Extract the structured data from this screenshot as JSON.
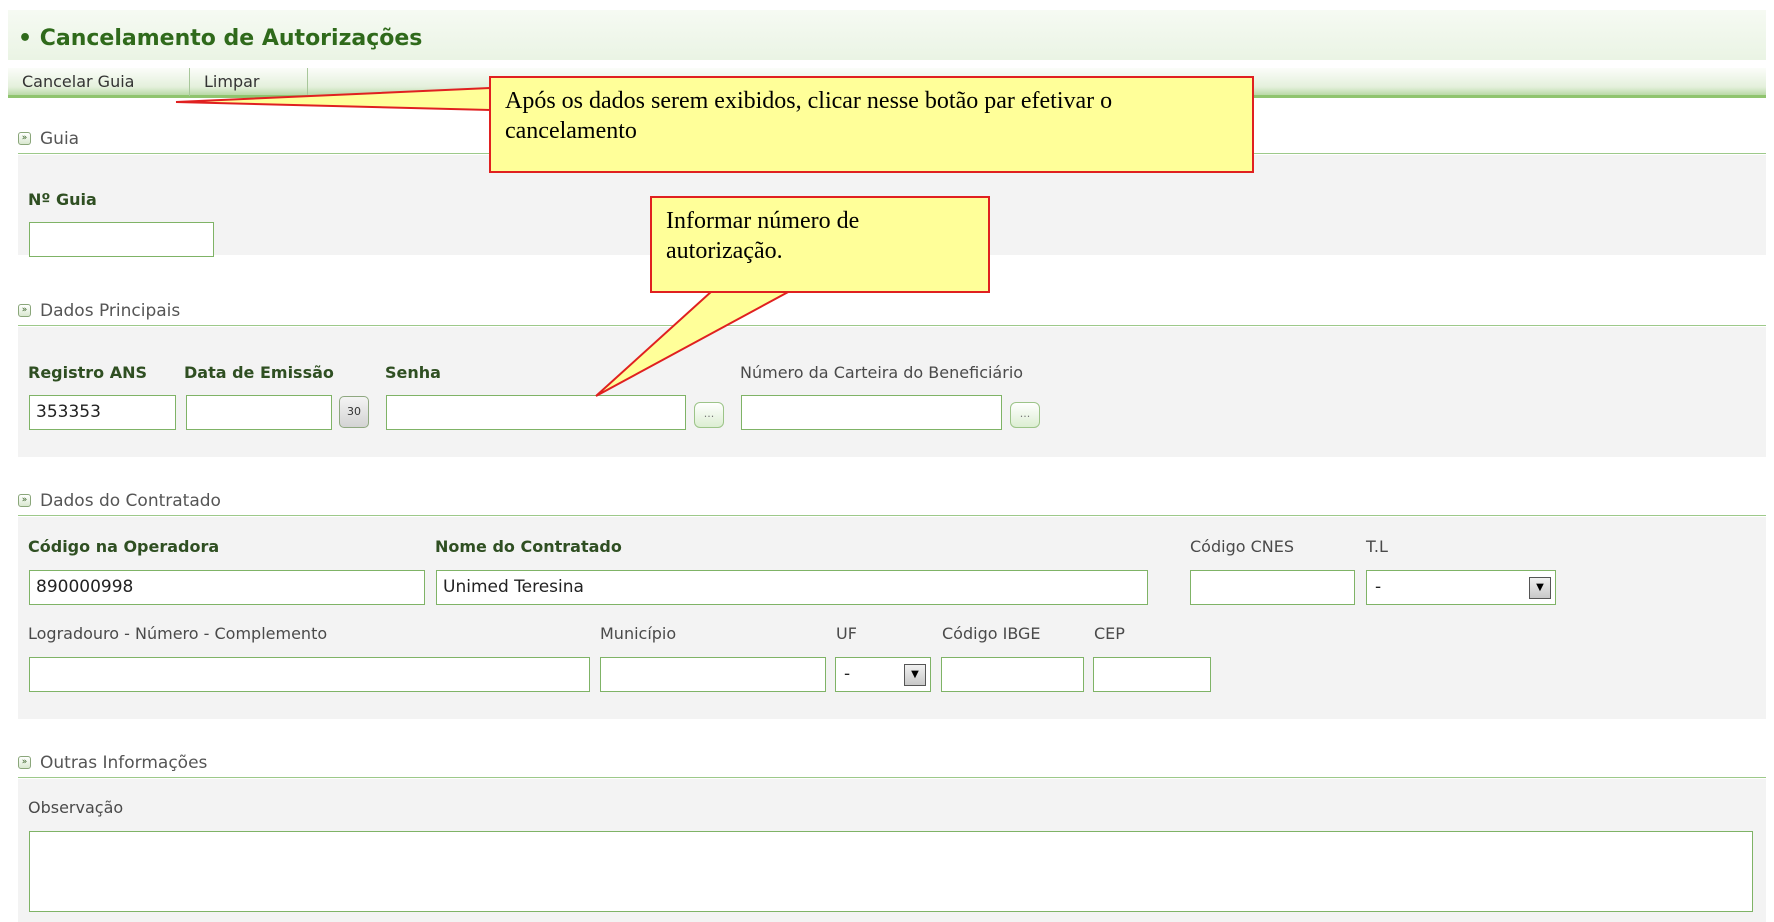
{
  "header": {
    "title": "Cancelamento de Autorizações"
  },
  "toolbar": {
    "cancel_label": "Cancelar Guia",
    "clear_label": "Limpar"
  },
  "sections": {
    "guia": "Guia",
    "dados_principais": "Dados Principais",
    "dados_contratado": "Dados do Contratado",
    "outras_informacoes": "Outras Informações"
  },
  "guia": {
    "numero_label": "Nº Guia",
    "numero_value": ""
  },
  "dados_principais": {
    "registro_ans_label": "Registro ANS",
    "registro_ans_value": "353353",
    "data_emissao_label": "Data de Emissão",
    "calendar_text": "30",
    "senha_label": "Senha",
    "carteira_label": "Número da Carteira do Beneficiário",
    "lookup_text": "..."
  },
  "contratado": {
    "codigo_operadora_label": "Código na Operadora",
    "codigo_operadora_value": "890000998",
    "nome_label": "Nome do Contratado",
    "nome_value": "Unimed Teresina",
    "cnes_label": "Código CNES",
    "tl_label": "T.L",
    "tl_value": "-",
    "logradouro_label": "Logradouro - Número - Complemento",
    "municipio_label": "Município",
    "uf_label": "UF",
    "uf_value": "-",
    "ibge_label": "Código IBGE",
    "cep_label": "CEP"
  },
  "outras": {
    "observacao_label": "Observação"
  },
  "annotations": {
    "cancel_note": "Após os dados serem exibidos, clicar nesse botão par efetivar o cancelamento",
    "numero_note": "Informar número de autorização."
  },
  "colors": {
    "accent_green": "#2f6a1b",
    "field_border": "#7fb366",
    "callout_fill": "#ffff99",
    "callout_border": "#e02020"
  }
}
